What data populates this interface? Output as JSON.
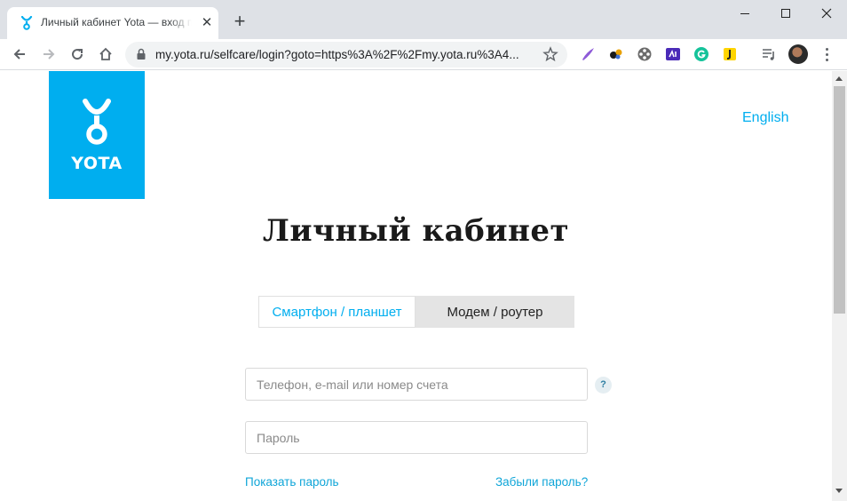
{
  "browser": {
    "tab": {
      "title": "Личный кабинет Yota — вход п",
      "close_glyph": "✕"
    },
    "new_tab_glyph": "+",
    "address_bar": {
      "url": "my.yota.ru/selfcare/login?goto=https%3A%2F%2Fmy.yota.ru%3A4..."
    },
    "extensions": [
      "quill-extension-icon",
      "dots-extension-icon",
      "film-reel-extension-icon",
      "purple-ad-extension-icon",
      "grammarly-extension-icon",
      "yellow-extension-icon",
      "media-queue-icon"
    ]
  },
  "page": {
    "logo_text": "YOTA",
    "language_link": "English",
    "title": "Личный кабинет",
    "device_tabs": {
      "smartphone": "Смартфон / планшет",
      "modem": "Модем / роутер",
      "active": "smartphone"
    },
    "login_field": {
      "placeholder": "Телефон, e-mail или номер счета",
      "value": ""
    },
    "help_glyph": "?",
    "password_field": {
      "placeholder": "Пароль",
      "value": ""
    },
    "show_password": "Показать пароль",
    "forgot_password": "Забыли пароль?"
  },
  "colors": {
    "brand": "#00aeef",
    "tab_strip": "#dee1e6",
    "inactive_tab": "#e4e4e4"
  }
}
